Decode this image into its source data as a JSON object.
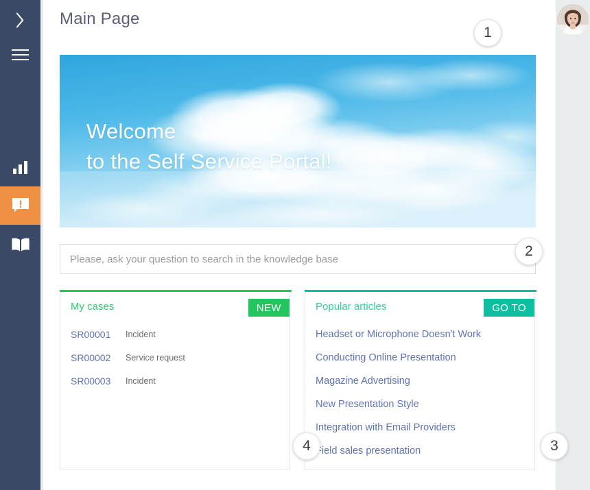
{
  "app": {
    "accent_sidebar": "#3a4a66",
    "accent_active": "#ef9145",
    "accent_green": "#22c55e",
    "accent_teal": "#0dbfa1",
    "link_color": "#5f73b8"
  },
  "sidebar": {
    "expand_icon": "chevron-right-icon",
    "menu_icon": "hamburger-menu-icon",
    "items": [
      {
        "icon": "bar-chart-icon",
        "active": false
      },
      {
        "icon": "comment-alert-icon",
        "active": true
      },
      {
        "icon": "open-book-icon",
        "active": false
      }
    ]
  },
  "header": {
    "title": "Main Page",
    "avatar_icon": "user-avatar"
  },
  "banner": {
    "line1": "Welcome",
    "line2": "to the Self Service Portal!",
    "background_icon": "sky-clouds-photo"
  },
  "search": {
    "placeholder": "Please, ask your question to search in the knowledge base",
    "value": ""
  },
  "panels": {
    "cases": {
      "title": "My cases",
      "button_label": "NEW",
      "rows": [
        {
          "id": "SR00001",
          "type": "Incident"
        },
        {
          "id": "SR00002",
          "type": "Service request"
        },
        {
          "id": "SR00003",
          "type": "Incident"
        }
      ]
    },
    "articles": {
      "title": "Popular articles",
      "button_label": "GO TO",
      "rows": [
        {
          "title": "Headset or Microphone Doesn't Work"
        },
        {
          "title": "Conducting Online Presentation"
        },
        {
          "title": "Magazine Advertising"
        },
        {
          "title": "New Presentation Style"
        },
        {
          "title": "Integration with Email Providers"
        },
        {
          "title": "Field sales presentation"
        }
      ]
    }
  },
  "badges": {
    "one": "1",
    "two": "2",
    "three": "3",
    "four": "4"
  }
}
